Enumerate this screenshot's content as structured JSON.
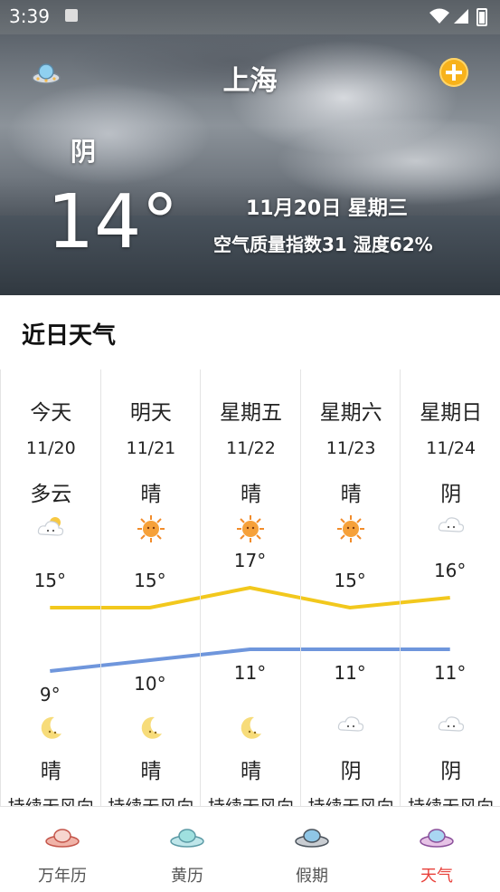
{
  "status_bar": {
    "time": "3:39"
  },
  "header": {
    "city": "上海"
  },
  "current": {
    "condition": "阴",
    "temperature": "14°",
    "date": "11月20日 星期三",
    "aqi_humidity": "空气质量指数31   湿度62%"
  },
  "section": {
    "title": "近日天气"
  },
  "forecast": [
    {
      "day": "今天",
      "date": "11/20",
      "day_weather": "多云",
      "high": 15,
      "low": 9,
      "night_weather": "晴",
      "wind": "持续无风向",
      "day_icon": "partly-cloudy-icon",
      "night_icon": "moon-icon"
    },
    {
      "day": "明天",
      "date": "11/21",
      "day_weather": "晴",
      "high": 15,
      "low": 10,
      "night_weather": "晴",
      "wind": "持续无风向",
      "day_icon": "sun-icon",
      "night_icon": "moon-icon"
    },
    {
      "day": "星期五",
      "date": "11/22",
      "day_weather": "晴",
      "high": 17,
      "low": 11,
      "night_weather": "晴",
      "wind": "持续无风向",
      "day_icon": "sun-icon",
      "night_icon": "moon-icon"
    },
    {
      "day": "星期六",
      "date": "11/23",
      "day_weather": "晴",
      "high": 15,
      "low": 11,
      "night_weather": "阴",
      "wind": "持续无风向",
      "day_icon": "sun-icon",
      "night_icon": "cloud-icon"
    },
    {
      "day": "星期日",
      "date": "11/24",
      "day_weather": "阴",
      "high": 16,
      "low": 11,
      "night_weather": "阴",
      "wind": "持续无风向",
      "day_icon": "cloud-icon",
      "night_icon": "cloud-icon"
    }
  ],
  "colors": {
    "high_line": "#f2c81d",
    "low_line": "#6f96dc",
    "active_tab": "#e8413b"
  },
  "tabs": [
    {
      "label": "万年历",
      "active": false
    },
    {
      "label": "黄历",
      "active": false
    },
    {
      "label": "假期",
      "active": false
    },
    {
      "label": "天气",
      "active": true
    }
  ]
}
